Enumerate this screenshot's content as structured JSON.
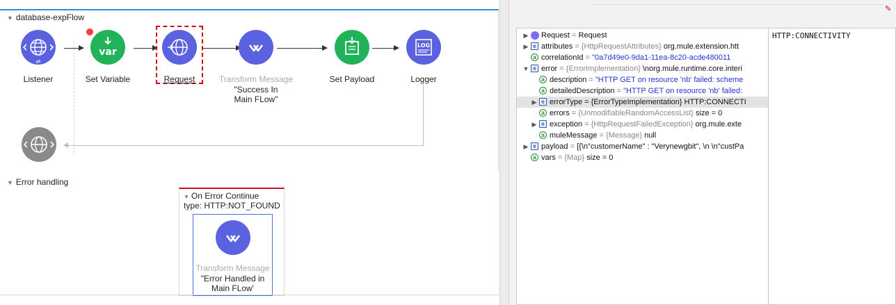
{
  "flow": {
    "name": "database-expFlow",
    "nodes": [
      {
        "label": "Listener",
        "icon": "globe-icon",
        "color": "#5b62e0"
      },
      {
        "label": "Set Variable",
        "icon": "var-icon",
        "icon_text": "var",
        "color": "#22b35a"
      },
      {
        "label": "Request",
        "icon": "globe-arrow-icon",
        "color": "#5b62e0"
      },
      {
        "label": "Transform Message",
        "sub": "\"Success In Main FLow\"",
        "icon": "transform-icon",
        "color": "#5b62e0"
      },
      {
        "label": "Set Payload",
        "icon": "payload-icon",
        "color": "#22b35a"
      },
      {
        "label": "Logger",
        "icon": "log-icon",
        "icon_text": "LOG",
        "color": "#5b62e0"
      }
    ],
    "response_icon": "globe-icon"
  },
  "error_handling": {
    "title": "Error handling",
    "handler_title": "On Error Continue",
    "handler_type": "type: HTTP:NOT_FOUND",
    "node_label": "Transform Message",
    "node_sub": "\"Error Handled in Main FLow'"
  },
  "debugger": {
    "value": "HTTP:CONNECTIVITY",
    "rows": [
      {
        "key": "Request",
        "eq": " = ",
        "type": "",
        "value": "Request"
      },
      {
        "key": "attributes",
        "eq": " = ",
        "type": "{HttpRequestAttributes}",
        "value": " org.mule.extension.htt"
      },
      {
        "key": "correlationId",
        "eq": " = ",
        "type": "",
        "value": "\"0a7d49e0-9da1-11ea-8c20-acde480011"
      },
      {
        "key": "error",
        "eq": " = ",
        "type": "{ErrorImplementation}",
        "value": " \\norg.mule.runtime.core.interi"
      },
      {
        "key": "description",
        "eq": " = ",
        "type": "",
        "value": "\"HTTP GET on resource 'nb' failed: scheme"
      },
      {
        "key": "detailedDescription",
        "eq": " = ",
        "type": "",
        "value": "\"HTTP GET on resource 'nb' failed:"
      },
      {
        "key": "errorType = {ErrorTypeImplementation} HTTP:CONNECTI",
        "eq": "",
        "type": "",
        "value": ""
      },
      {
        "key": "errors",
        "eq": " = ",
        "type": "{UnmodifiableRandomAccessList}",
        "value": " size = 0"
      },
      {
        "key": "exception",
        "eq": " = ",
        "type": "{HttpRequestFailedException}",
        "value": " org.mule.exte"
      },
      {
        "key": "muleMessage",
        "eq": " = ",
        "type": "{Message}",
        "value": " null"
      },
      {
        "key": "payload",
        "eq": " = ",
        "type": "",
        "value": "[{\\n\"customerName\" : \"Verynewgbit\", \\n \\n\"custPa"
      },
      {
        "key": "vars",
        "eq": " = ",
        "type": "{Map}",
        "value": " size = 0"
      }
    ]
  }
}
